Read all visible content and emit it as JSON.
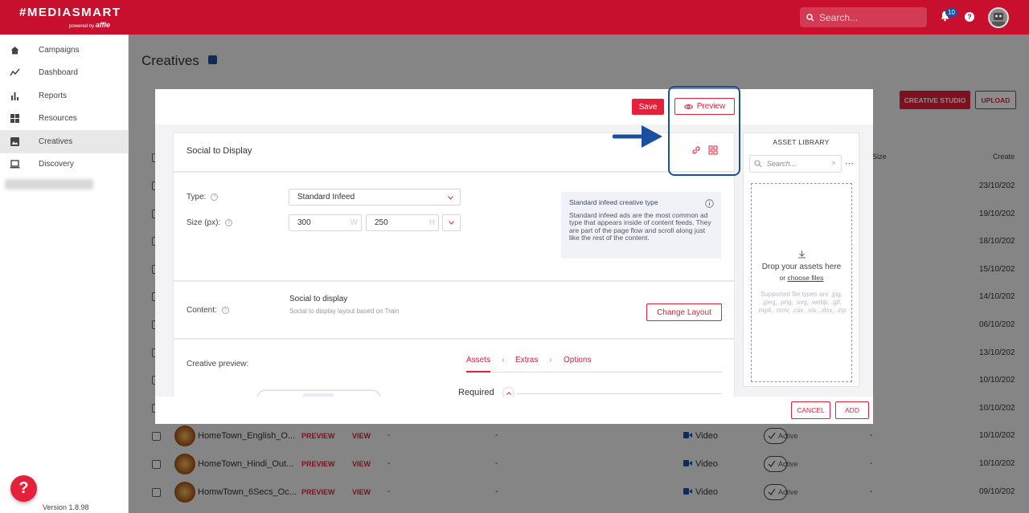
{
  "brand": {
    "logo": "#MEDIASMART",
    "powered_by": "powered by",
    "affle": "affle"
  },
  "header": {
    "search_placeholder": "Search...",
    "notification_count": "10"
  },
  "sidebar": {
    "items": [
      {
        "label": "Campaigns",
        "icon": "home-icon"
      },
      {
        "label": "Dashboard",
        "icon": "trend-icon"
      },
      {
        "label": "Reports",
        "icon": "bar-chart-icon"
      },
      {
        "label": "Resources",
        "icon": "grid-icon"
      },
      {
        "label": "Creatives",
        "icon": "image-icon"
      },
      {
        "label": "Discovery",
        "icon": "laptop-icon"
      }
    ],
    "version": "Version 1.8.98"
  },
  "page": {
    "title": "Creatives",
    "creative_studio": "CREATIVE STUDIO",
    "upload": "UPLOAD"
  },
  "table": {
    "col_size": "Size",
    "col_created": "Create",
    "bg_dates": [
      "23/10/202",
      "19/10/202",
      "18/10/202",
      "15/10/202",
      "14/10/202",
      "06/10/202",
      "13/10/202",
      "10/10/202",
      "10/10/202"
    ],
    "rows": [
      {
        "name": "HomeTown_English_O...",
        "preview": "PREVIEW",
        "view": "VIEW",
        "a": "-",
        "b": "-",
        "type": "Video",
        "status": "Active",
        "c": "-",
        "date": "10/10/202"
      },
      {
        "name": "HomeTown_Hindi_Out...",
        "preview": "PREVIEW",
        "view": "VIEW",
        "a": "-",
        "b": "-",
        "type": "Video",
        "status": "Active",
        "c": "-",
        "date": "10/10/202"
      },
      {
        "name": "HomwTown_6Secs_Oc...",
        "preview": "PREVIEW",
        "view": "VIEW",
        "a": "-",
        "b": "-",
        "type": "Video",
        "status": "Active",
        "c": "-",
        "date": "09/10/202"
      }
    ]
  },
  "modal": {
    "save": "Save",
    "preview": "Preview",
    "section_title": "Social to Display",
    "type_label": "Type:",
    "type_value": "Standard Infeed",
    "size_label": "Size (px):",
    "width": "300",
    "width_unit": "W",
    "height": "250",
    "height_unit": "H",
    "info_title": "Standard infeed creative type",
    "info_text": "Standard infeed ads are the most common ad type that appears inside of content feeds. They are part of the page flow and scroll along just like the rest of the content.",
    "content_label": "Content:",
    "content_title": "Social to display",
    "content_sub": "Social to display layout based on Train",
    "change_layout": "Change Layout",
    "creative_preview_label": "Creative preview:",
    "tabs": [
      "Assets",
      "Extras",
      "Options"
    ],
    "required": "Required",
    "cancel": "CANCEL",
    "add": "ADD"
  },
  "asset_library": {
    "title": "ASSET LIBRARY",
    "search_placeholder": "Search...",
    "drop_text": "Drop your assets here",
    "or": "or",
    "choose_files": "choose files",
    "supported": "Supported file types are .jpg, .jpeg, .png, .svg, .webp, .gif, .mp4, .mov, .csv, .xls, .xlsx, .zip"
  },
  "colors": {
    "brand_red": "#c8102e",
    "accent_red": "#e5203a",
    "highlight_blue": "#1a4fa0"
  }
}
